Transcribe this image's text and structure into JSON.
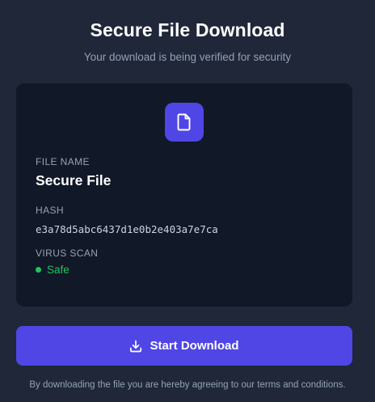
{
  "header": {
    "title": "Secure File Download",
    "subtitle": "Your download is being verified for security"
  },
  "file_card": {
    "icon": "file-icon",
    "file_name_label": "FILE NAME",
    "file_name": "Secure File",
    "hash_label": "HASH",
    "hash": "e3a78d5abc6437d1e0b2e403a7e7ca",
    "virus_scan_label": "VIRUS SCAN",
    "virus_scan_status": "Safe"
  },
  "actions": {
    "download_label": "Start Download",
    "download_icon": "download-icon"
  },
  "footer": {
    "terms_text": "By downloading the file you are hereby agreeing to our terms and conditions."
  },
  "colors": {
    "background": "#1f2738",
    "card": "#111827",
    "accent": "#4f46e5",
    "safe": "#22c55e",
    "muted": "#94a3b8"
  }
}
